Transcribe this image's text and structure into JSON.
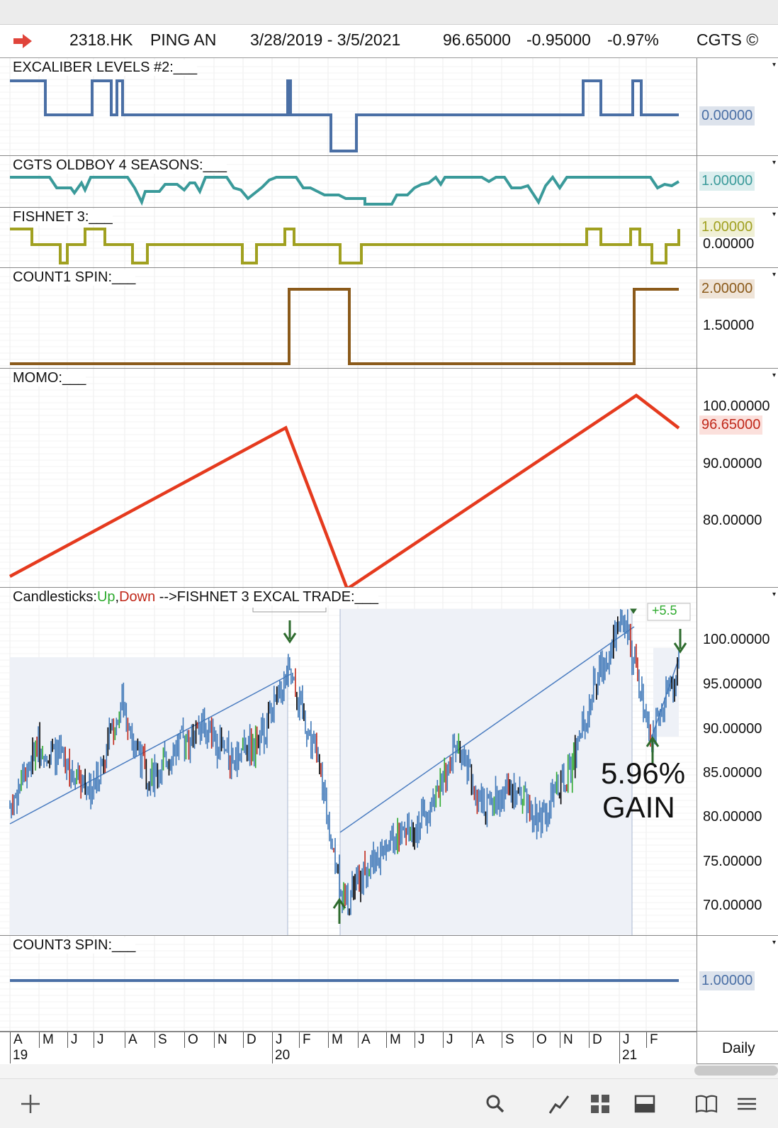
{
  "header": {
    "symbol": "2318.HK",
    "name": "PING AN",
    "date_range": "3/28/2019 - 3/5/2021",
    "last_price": "96.65000",
    "change": "-0.95000",
    "change_pct": "-0.97%",
    "brand": "CGTS ©"
  },
  "panels": {
    "excal": {
      "label": "EXCALIBER LEVELS #2:___",
      "value": "0.00000",
      "color": "#4a6fa5"
    },
    "oldboy": {
      "label": "CGTS OLDBOY 4 SEASONS:___",
      "value": "1.00000",
      "color": "#3a9a9a"
    },
    "fishnet": {
      "label": "FISHNET 3:___",
      "value": "1.00000",
      "value2": "0.00000",
      "color": "#a0a020"
    },
    "count1": {
      "label": "COUNT1 SPIN:___",
      "value": "2.00000",
      "tick": "1.50000",
      "color": "#8b5a1a"
    },
    "momo": {
      "label": "MOMO:___",
      "value": "96.65000",
      "ticks": [
        "100.00000",
        "90.00000",
        "80.00000"
      ],
      "color": "#e53a1e"
    },
    "candles": {
      "label_prefix": "Candlesticks:",
      "label_up": "Up",
      "label_sep": ",",
      "label_down": "Down",
      "label_trade": "  -->FISHNET 3 EXCAL TRADE:___",
      "up_color": "#2eaa2e",
      "down_color": "#c0281a",
      "ticks": [
        "100.00000",
        "95.00000",
        "90.00000",
        "85.00000",
        "80.00000",
        "75.00000",
        "70.00000"
      ],
      "gain_pct": "5.96%",
      "gain_word": "GAIN",
      "partial_box": "+5.5"
    },
    "count3": {
      "label": "COUNT3 SPIN:___",
      "value": "1.00000",
      "color": "#4a6fa5"
    }
  },
  "timeline": {
    "months": [
      "A",
      "M",
      "J",
      "J",
      "A",
      "S",
      "O",
      "N",
      "D",
      "J",
      "F",
      "M",
      "A",
      "M",
      "J",
      "J",
      "A",
      "S",
      "O",
      "N",
      "D",
      "J",
      "F"
    ],
    "years": [
      "19",
      "20",
      "21"
    ],
    "period": "Daily"
  },
  "toolbar": [
    "plus-icon",
    "search-icon",
    "draw-icon",
    "grid-icon",
    "layout-icon",
    "book-icon",
    "menu-icon"
  ],
  "chart_data": [
    {
      "type": "line",
      "title": "EXCALIBER LEVELS #2",
      "x": [
        "2019-03",
        "2019-06",
        "2019-07",
        "2020-01",
        "2020-03",
        "2020-04",
        "2020-12",
        "2021-01",
        "2021-03"
      ],
      "values": [
        1,
        0,
        1,
        1,
        -1,
        0,
        1,
        0,
        0
      ]
    },
    {
      "type": "line",
      "title": "CGTS OLDBOY 4 SEASONS",
      "x": [
        "2019-03",
        "2019-06",
        "2019-09",
        "2020-01",
        "2020-04",
        "2020-07",
        "2020-11",
        "2021-02",
        "2021-03"
      ],
      "values": [
        1,
        0.5,
        1,
        1,
        0,
        0.5,
        1,
        0.5,
        1
      ]
    },
    {
      "type": "line",
      "title": "FISHNET 3",
      "x": [
        "2019-03",
        "2019-06",
        "2019-09",
        "2020-01",
        "2020-04",
        "2020-12",
        "2021-02",
        "2021-03"
      ],
      "values": [
        1,
        0,
        1,
        1,
        -1,
        0,
        0,
        1
      ]
    },
    {
      "type": "line",
      "title": "COUNT1 SPIN",
      "x": [
        "2019-03",
        "2020-01-13",
        "2020-03-18",
        "2021-01-18",
        "2021-03-05"
      ],
      "values": [
        1,
        2,
        1,
        2,
        2
      ]
    },
    {
      "type": "line",
      "title": "MOMO",
      "x": [
        "2019-03-28",
        "2020-01-14",
        "2020-03-19",
        "2021-01-19",
        "2021-03-05"
      ],
      "values": [
        70.5,
        96.7,
        68.3,
        102.4,
        96.65
      ]
    },
    {
      "type": "line",
      "title": "Candlesticks",
      "x": [
        "2019-03",
        "2019-04",
        "2019-05",
        "2019-06",
        "2019-07",
        "2019-08",
        "2019-09",
        "2019-10",
        "2019-11",
        "2019-12",
        "2020-01",
        "2020-02",
        "2020-03",
        "2020-04",
        "2020-05",
        "2020-06",
        "2020-07",
        "2020-08",
        "2020-09",
        "2020-10",
        "2020-11",
        "2020-12",
        "2021-01",
        "2021-02",
        "2021-03"
      ],
      "values": [
        81,
        88,
        86,
        83,
        93,
        84,
        88,
        90,
        86,
        89,
        96,
        87,
        70,
        75,
        78,
        80,
        88,
        81,
        83,
        80,
        84,
        95,
        103,
        89,
        96.65
      ],
      "ylim": [
        67,
        103
      ]
    },
    {
      "type": "line",
      "title": "COUNT3 SPIN",
      "x": [
        "2019-03",
        "2021-03"
      ],
      "values": [
        1,
        1
      ]
    }
  ]
}
